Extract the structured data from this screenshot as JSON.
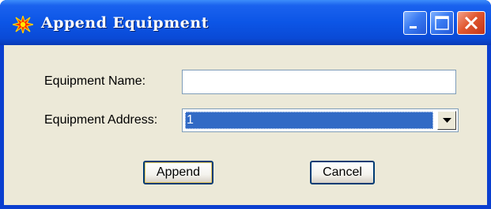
{
  "window": {
    "title": "Append Equipment",
    "icon": "explosion-icon"
  },
  "titlebar_buttons": {
    "minimize": "minimize-icon",
    "maximize": "maximize-icon",
    "close": "close-icon"
  },
  "form": {
    "name_label": "Equipment Name:",
    "name_value": "",
    "address_label": "Equipment Address:",
    "address_value": "1"
  },
  "buttons": {
    "append_label": "Append",
    "cancel_label": "Cancel"
  },
  "colors": {
    "titlebar": "#0c55e6",
    "selection": "#316ac5",
    "dialog_bg": "#ece9d8",
    "close_button": "#e1582f"
  }
}
